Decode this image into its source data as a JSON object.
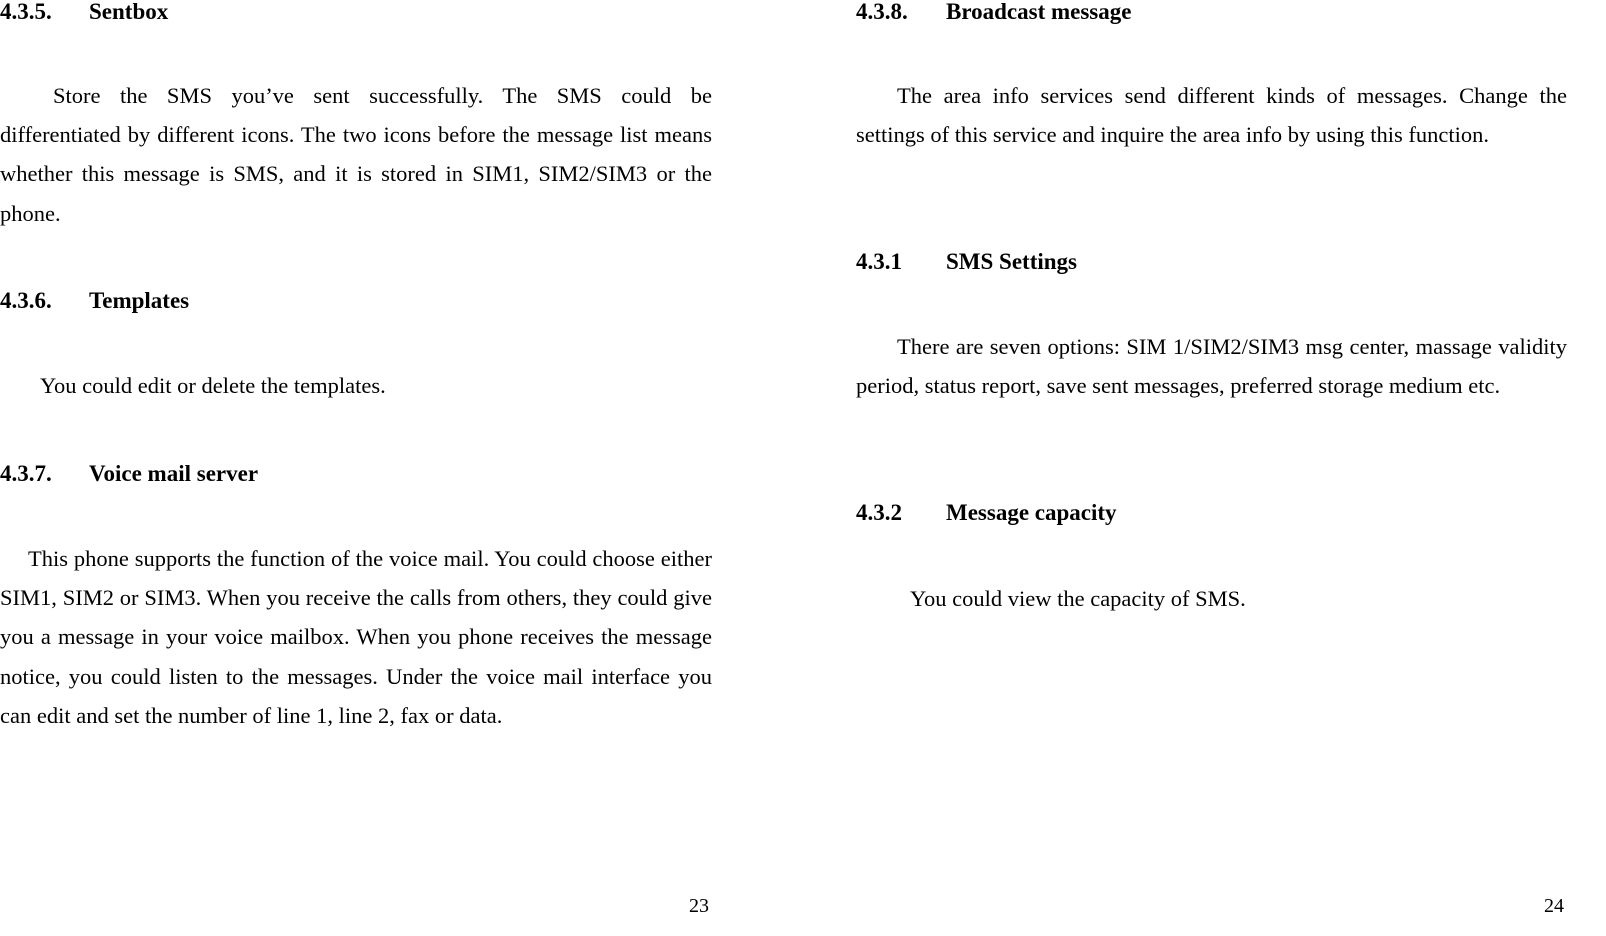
{
  "left_page": {
    "sections": [
      {
        "number": "4.3.5.",
        "title": "Sentbox",
        "body": "Store the SMS you’ve sent successfully. The SMS could be differentiated by different icons. The two icons before the message list means whether this message is SMS, and it is stored in SIM1, SIM2/SIM3 or the phone."
      },
      {
        "number": "4.3.6.",
        "title": "Templates",
        "body": "You could edit or delete the templates."
      },
      {
        "number": "4.3.7.",
        "title": "Voice mail server",
        "body": "This phone supports the function of the voice mail. You could choose either SIM1, SIM2 or SIM3. When you receive the calls from others, they could give you a message in your voice mailbox. When you phone receives the message notice, you could listen to the messages. Under the voice mail interface you can edit and set the number of line 1, line 2, fax or data."
      }
    ],
    "page_number": "23"
  },
  "right_page": {
    "sections": [
      {
        "number": "4.3.8.",
        "title": "Broadcast message",
        "body": "The area info services send different kinds of messages. Change the settings of this service and inquire the area info by using this function."
      },
      {
        "number": "4.3.1",
        "title": "SMS Settings",
        "body": "There are seven options: SIM 1/SIM2/SIM3 msg center, massage validity period, status report, save sent messages, preferred storage medium etc."
      },
      {
        "number": "4.3.2",
        "title": "Message capacity",
        "body": "You could view the capacity of SMS."
      }
    ],
    "page_number": "24"
  }
}
